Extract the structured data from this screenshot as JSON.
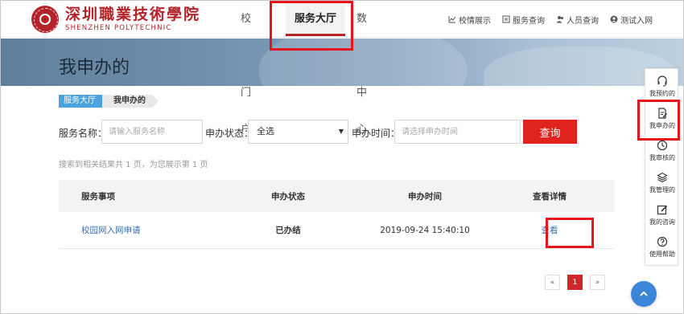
{
  "logo": {
    "name_cn": "深圳職業技術學院",
    "name_en": "SHENZHEN POLYTECHNIC"
  },
  "nav": {
    "items": [
      "校园门户",
      "服务大厅",
      "数据中心"
    ],
    "active": "服务大厅"
  },
  "toplinks": [
    {
      "label": "校情展示",
      "icon": "chart-icon"
    },
    {
      "label": "服务查询",
      "icon": "list-icon"
    },
    {
      "label": "人员查询",
      "icon": "users-icon"
    },
    {
      "label": "测试入网",
      "icon": "user-circle-icon"
    }
  ],
  "banner": {
    "title": "我申办的"
  },
  "breadcrumb": {
    "parent": "服务大厅",
    "current": "我申办的"
  },
  "search": {
    "name_label": "服务名称：",
    "name_placeholder": "请输入服务名称",
    "status_label": "申办状态：",
    "status_value": "全选",
    "time_label": "申办时间：",
    "time_placeholder": "请选择申办时间",
    "button": "查询"
  },
  "result_text": "搜索到相关结果共 1 页，为您展示第 1 页",
  "table": {
    "headers": [
      "服务事项",
      "申办状态",
      "申办时间",
      "查看详情"
    ],
    "rows": [
      {
        "service": "校园网入网申请",
        "status": "已办结",
        "time": "2019-09-24 15:40:10",
        "action": "查看"
      }
    ]
  },
  "pagination": {
    "prev": "«",
    "current": "1",
    "next": "»"
  },
  "rail": [
    {
      "label": "我预约的",
      "icon": "headset-icon"
    },
    {
      "label": "我申办的",
      "icon": "edit-doc-icon"
    },
    {
      "label": "我审核的",
      "icon": "clock-icon"
    },
    {
      "label": "我管理的",
      "icon": "layers-icon"
    },
    {
      "label": "我的咨询",
      "icon": "pencil-square-icon"
    },
    {
      "label": "使用帮助",
      "icon": "help-icon"
    }
  ],
  "colors": {
    "brand_red": "#b4232a",
    "button_red": "#e0231f",
    "highlight_red": "#e8141c",
    "breadcrumb_blue": "#4aa3df",
    "fab_blue": "#3b86d8"
  }
}
